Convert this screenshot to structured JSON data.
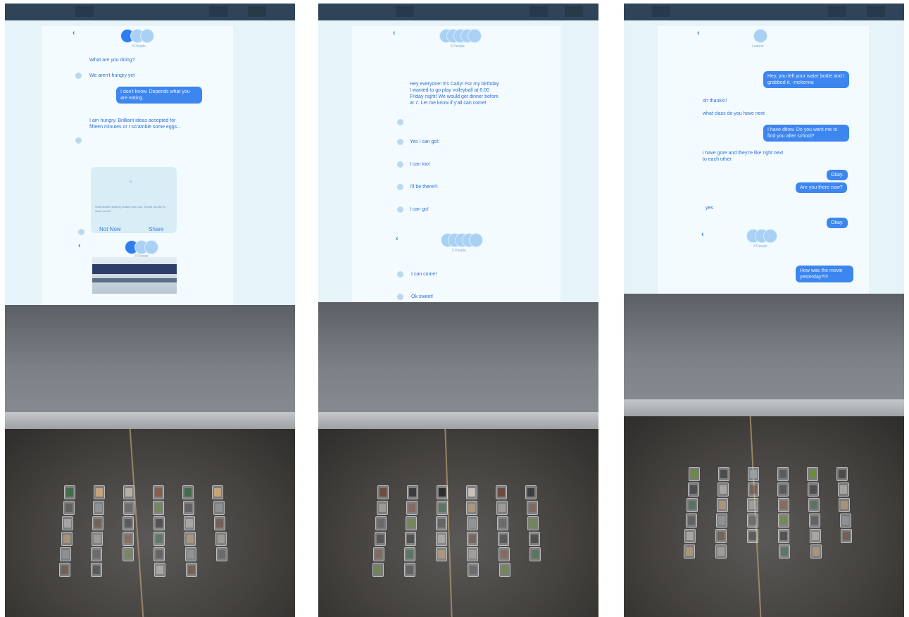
{
  "panels": [
    {
      "chat": {
        "back_label": "‹",
        "people_label": "3 People",
        "messages": [
          {
            "dir": "in",
            "text": "What are you doing?"
          },
          {
            "dir": "in",
            "text": "We aren't hungry yet"
          },
          {
            "dir": "out",
            "text": "I don't know. Depends what you are eating."
          },
          {
            "dir": "in",
            "text": "I am hungry. Brilliant ideas accepted for fifteen minutes or I scramble some eggs..."
          }
        ],
        "location_card": {
          "text": "Scott started sharing location with you. Would you like to share yours?",
          "not_now": "Not Now",
          "share": "Share"
        },
        "second_header_people": "3 People"
      }
    },
    {
      "chat": {
        "back_label": "‹",
        "people_label": "5 People",
        "messages": [
          {
            "dir": "in",
            "text": "Hey everyone! It's Carly! For my birthday I wanted to go play volleyball at 6:00 Friday night! We would get dinner before at 7. Let me know if y'all can come!"
          },
          {
            "dir": "in",
            "text": "Yes I can go!!"
          },
          {
            "dir": "in",
            "text": "I can too!"
          },
          {
            "dir": "in",
            "text": "I'll be there!!!"
          },
          {
            "dir": "in",
            "text": "I can go!"
          }
        ],
        "second_messages": [
          {
            "dir": "in",
            "text": "I can come!"
          },
          {
            "dir": "in",
            "text": "Ok sweet!"
          }
        ],
        "second_header_people": "5 People"
      }
    },
    {
      "chat": {
        "back_label": "‹",
        "people_label": "Leanne",
        "messages": [
          {
            "dir": "out",
            "text": "Hey, you left your water bottle and I grabbed it. -mckenna"
          },
          {
            "dir": "in",
            "text": "oh thanks!!"
          },
          {
            "dir": "in",
            "text": "what class do you have next"
          },
          {
            "dir": "out",
            "text": "I have dtlow. Do you want me to find you after school?"
          },
          {
            "dir": "in",
            "text": "i have gore and they're like right next to each other"
          },
          {
            "dir": "out",
            "text": "Okay."
          },
          {
            "dir": "out",
            "text": "Are you there now?"
          },
          {
            "dir": "in",
            "text": "yes"
          },
          {
            "dir": "out",
            "text": "Okay."
          },
          {
            "dir": "out",
            "text": "How was the movie yesterday?!!!"
          }
        ],
        "second_header_people": "3 People"
      }
    }
  ],
  "colors": {
    "screen": "#e6f3f8",
    "bubble_out": "#3d86ef",
    "accent": "#2d7ef0",
    "wall": "#7c8087",
    "floor": "#45423f"
  }
}
